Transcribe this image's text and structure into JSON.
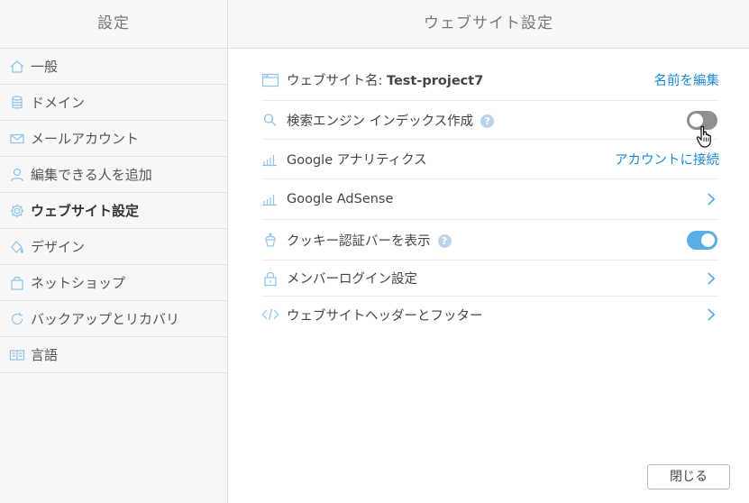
{
  "sidebar": {
    "title": "設定",
    "items": [
      {
        "label": "一般",
        "icon": "home-icon"
      },
      {
        "label": "ドメイン",
        "icon": "database-icon"
      },
      {
        "label": "メールアカウント",
        "icon": "mail-icon"
      },
      {
        "label": "編集できる人を追加",
        "icon": "user-icon"
      },
      {
        "label": "ウェブサイト設定",
        "icon": "gear-icon",
        "active": true
      },
      {
        "label": "デザイン",
        "icon": "paint-bucket-icon"
      },
      {
        "label": "ネットショップ",
        "icon": "shopping-bag-icon"
      },
      {
        "label": "バックアップとリカバリ",
        "icon": "refresh-icon"
      },
      {
        "label": "言語",
        "icon": "language-icon"
      }
    ]
  },
  "main": {
    "title": "ウェブサイト設定",
    "rows": {
      "site_name": {
        "label_prefix": "ウェブサイト名: ",
        "value": "Test-project7",
        "action": "名前を編集",
        "icon": "browser-window-icon"
      },
      "search_index": {
        "label": "検索エンジン インデックス作成",
        "help": "?",
        "toggle": "off",
        "icon": "search-icon"
      },
      "analytics": {
        "label": "Google アナリティクス",
        "action": "アカウントに接続",
        "icon": "bar-chart-icon"
      },
      "adsense": {
        "label": "Google AdSense",
        "icon": "bar-chart-icon"
      },
      "cookie_bar": {
        "label": "クッキー認証バーを表示",
        "help": "?",
        "toggle": "on",
        "icon": "cupcake-icon"
      },
      "member_login": {
        "label": "メンバーログイン設定",
        "icon": "lock-icon"
      },
      "header_footer": {
        "label": "ウェブサイトヘッダーとフッター",
        "icon": "code-icon"
      }
    }
  },
  "footer": {
    "close_label": "閉じる"
  },
  "colors": {
    "accent": "#1d8ad9",
    "toggle_on": "#5aaee8",
    "toggle_off": "#8f8f8f",
    "icon": "#8ec3ea"
  }
}
